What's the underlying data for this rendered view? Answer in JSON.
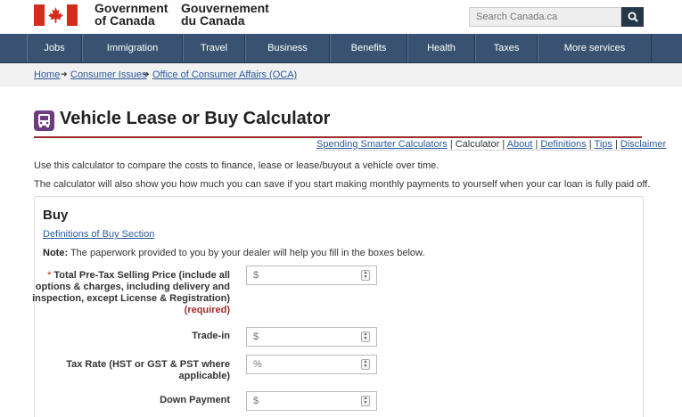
{
  "header": {
    "gov_en_line1": "Government",
    "gov_en_line2": "of Canada",
    "gov_fr_line1": "Gouvernement",
    "gov_fr_line2": "du Canada",
    "search_placeholder": "Search Canada.ca"
  },
  "nav": {
    "items": [
      {
        "label": "Jobs"
      },
      {
        "label": "Immigration"
      },
      {
        "label": "Travel"
      },
      {
        "label": "Business"
      },
      {
        "label": "Benefits"
      },
      {
        "label": "Health"
      },
      {
        "label": "Taxes"
      },
      {
        "label": "More services"
      }
    ]
  },
  "breadcrumb": {
    "home": "Home",
    "consumer_issues": "Consumer Issues",
    "oca": "Office of Consumer Affairs (OCA)"
  },
  "page": {
    "title": "Vehicle Lease or Buy Calculator",
    "sub_nav": {
      "spending": "Spending Smarter Calculators",
      "calculator": "Calculator",
      "about": "About",
      "definitions": "Definitions",
      "tips": "Tips",
      "disclaimer": "Disclaimer"
    },
    "intro1": "Use this calculator to compare the costs to finance, lease or lease/buyout a vehicle over time.",
    "intro2": "The calculator will also show you how much you can save if you start making monthly payments to yourself when your car loan is fully paid off."
  },
  "buy": {
    "title": "Buy",
    "definitions_link": "Definitions of Buy Section",
    "note_label": "Note:",
    "note_text": " The paperwork provided to you by your dealer will help you fill in the boxes below.",
    "fields": {
      "price": {
        "star": "* ",
        "line1": "Total Pre-Tax Selling Price (include all",
        "line2": "options & charges, including delivery and",
        "line3": "inspection, except License & Registration)",
        "required": "(required)",
        "placeholder": "$"
      },
      "trade_in": {
        "label": "Trade-in",
        "placeholder": "$"
      },
      "tax_rate": {
        "line1": "Tax Rate (HST or GST & PST where",
        "line2": "applicable)",
        "placeholder": "%"
      },
      "down_payment": {
        "label": "Down Payment",
        "placeholder": "$"
      }
    }
  },
  "colors": {
    "nav_bg": "#3a5271",
    "title_rule": "#9e2a2a",
    "link": "#2b5a9e",
    "flag_red": "#d52b1e"
  }
}
